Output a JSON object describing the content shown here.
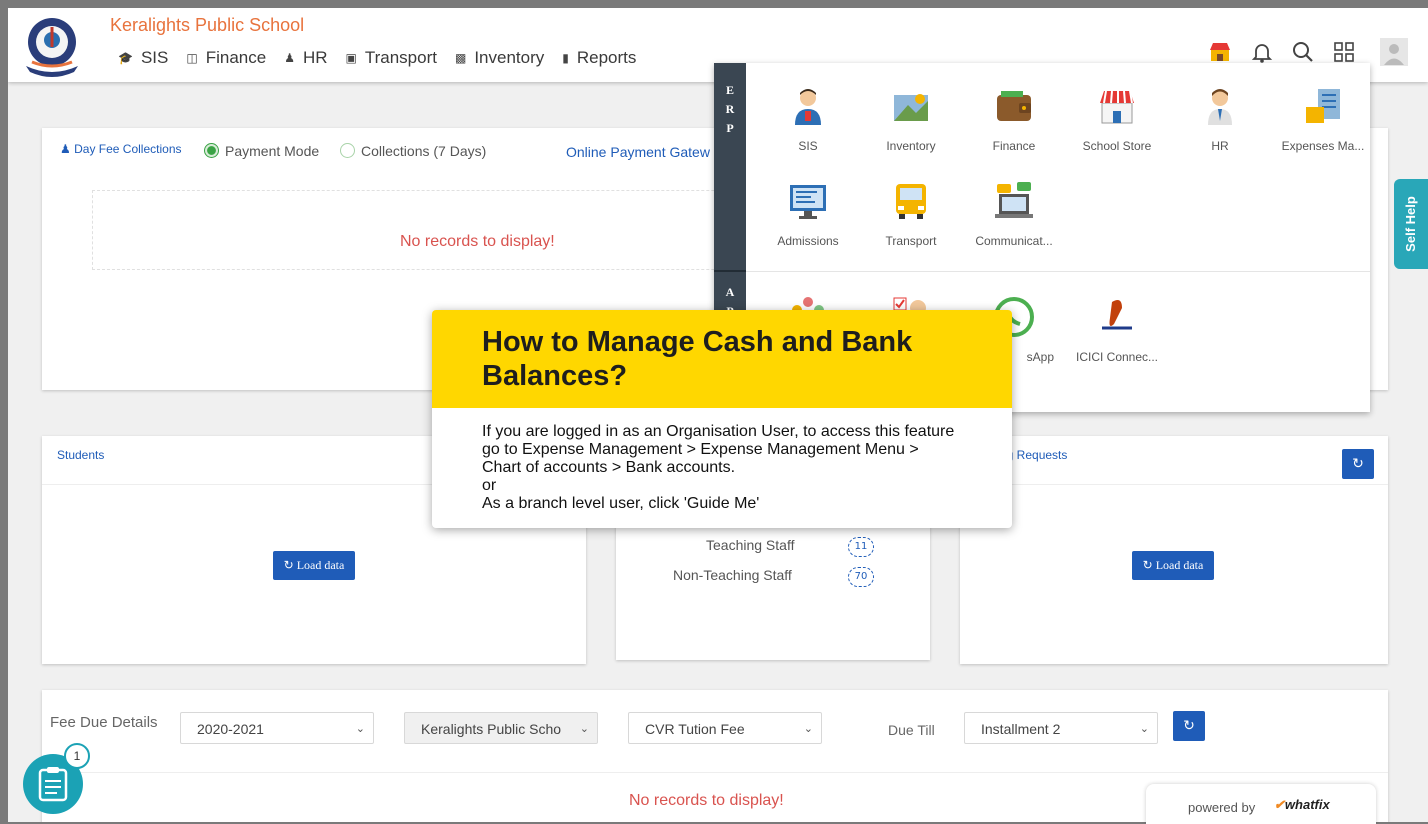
{
  "header": {
    "school_name": "Keralights Public School",
    "nav": [
      {
        "label": "SIS",
        "icon": "graduation-cap-icon"
      },
      {
        "label": "Finance",
        "icon": "money-icon"
      },
      {
        "label": "HR",
        "icon": "user-icon"
      },
      {
        "label": "Transport",
        "icon": "bus-icon"
      },
      {
        "label": "Inventory",
        "icon": "briefcase-icon"
      },
      {
        "label": "Reports",
        "icon": "bar-chart-icon"
      }
    ],
    "accent_color": "#e8733d"
  },
  "fee_collection_card": {
    "title": "Day Fee Collections",
    "radio_payment_mode": "Payment Mode",
    "radio_collections": "Collections (7 Days)",
    "selected": "Payment Mode",
    "online_gateway_link": "Online Payment Gatew",
    "empty_text": "No records to display!"
  },
  "students_card": {
    "title": "Students",
    "load_button": "Load data"
  },
  "staff_card": {
    "rows": [
      {
        "label": "Teaching Staff",
        "count": "11"
      },
      {
        "label": "Non-Teaching Staff",
        "count": "70"
      }
    ]
  },
  "requests_card": {
    "title": "ng Requests",
    "load_button": "Load data"
  },
  "fee_due_card": {
    "title": "Fee Due Details",
    "year": "2020-2021",
    "school": "Keralights Public Scho",
    "fee_type": "CVR Tution Fee",
    "due_till_label": "Due Till",
    "installment": "Installment 2",
    "empty_text": "No records to display!"
  },
  "app_drawer": {
    "section_erp": "ERP",
    "section_ap": "AP",
    "apps": [
      {
        "label": "SIS"
      },
      {
        "label": "Inventory"
      },
      {
        "label": "Finance"
      },
      {
        "label": "School Store"
      },
      {
        "label": "HR"
      },
      {
        "label": "Expenses Ma..."
      },
      {
        "label": "Admissions"
      },
      {
        "label": "Transport"
      },
      {
        "label": "Communicat..."
      }
    ],
    "addons": [
      {
        "label": "sApp"
      },
      {
        "label": "ICICI Connec..."
      }
    ]
  },
  "self_help": "Self Help",
  "popup": {
    "title": "How to Manage Cash and Bank Balances?",
    "lines": [
      "If you are logged in as an Organisation User, to access this feature",
      "go to Expense Management > Expense Management Menu >",
      "Chart of accounts > Bank accounts.",
      "or",
      "As a branch level user, click 'Guide Me'"
    ],
    "header_color": "#ffd700"
  },
  "powered_by": {
    "text": "powered by",
    "brand": "whatfix"
  },
  "checklist_badge": "1"
}
